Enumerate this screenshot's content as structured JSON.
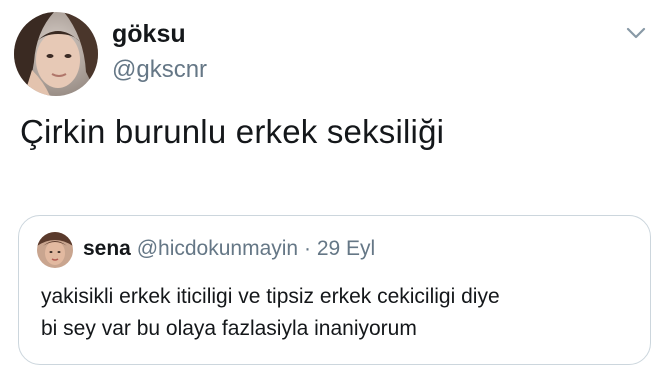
{
  "tweet": {
    "display_name": "göksu",
    "handle": "@gkscnr",
    "text": "Çirkin burunlu erkek seksiliği",
    "avatar_icon": "profile-photo",
    "menu_icon": "chevron-down-icon"
  },
  "quote": {
    "display_name": "sena",
    "handle": "@hicdokunmayin",
    "separator": "·",
    "date": "29 Eyl",
    "text_line1": "yakisikli erkek iticiligi ve tipsiz erkek cekiciligi diye",
    "text_line2": "bi sey var bu olaya fazlasiyla inaniyorum",
    "avatar_icon": "profile-photo"
  },
  "colors": {
    "text_primary": "#14171a",
    "text_secondary": "#657786",
    "border": "#ccd6dd",
    "background": "#ffffff"
  }
}
